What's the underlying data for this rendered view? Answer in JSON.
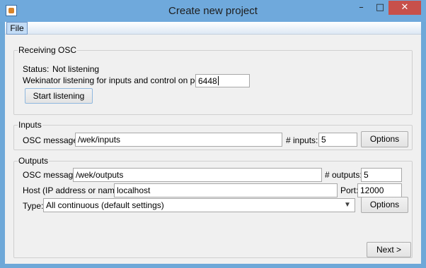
{
  "window": {
    "title": "Create new project",
    "minimize_glyph": "–",
    "maximize_glyph": "□",
    "close_glyph": "✕"
  },
  "menu": {
    "file": "File"
  },
  "receiving_osc": {
    "legend": "Receiving OSC",
    "status_label": "Status:",
    "status_value": "Not listening",
    "port_label": "Wekinator listening for inputs and control on port:",
    "port_value": "6448",
    "start_button": "Start listening"
  },
  "inputs": {
    "legend": "Inputs",
    "osc_message_label": "OSC message:",
    "osc_message_value": "/wek/inputs",
    "num_inputs_label": "# inputs:",
    "num_inputs_value": "5",
    "options_button": "Options"
  },
  "outputs": {
    "legend": "Outputs",
    "osc_message_label": "OSC message:",
    "osc_message_value": "/wek/outputs",
    "num_outputs_label": "# outputs:",
    "num_outputs_value": "5",
    "host_label": "Host (IP address or name):",
    "host_value": "localhost",
    "port_label": "Port:",
    "port_value": "12000",
    "type_label": "Type:",
    "type_value": "All continuous (default settings)",
    "options_button": "Options"
  },
  "next_button": "Next >"
}
